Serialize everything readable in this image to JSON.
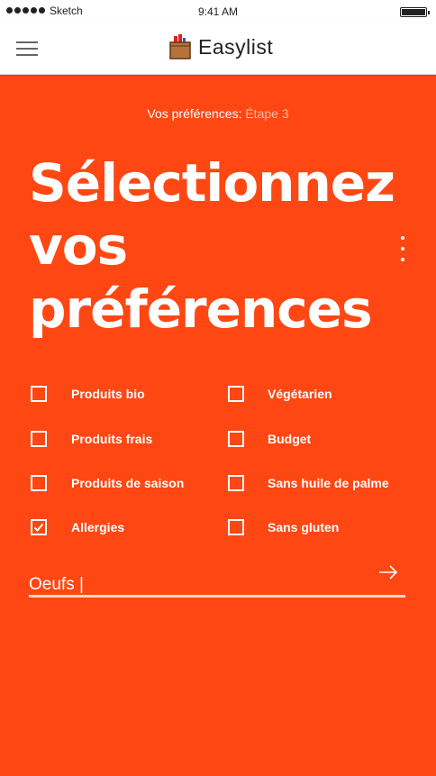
{
  "status_bar": {
    "carrier": "Sketch",
    "time": "9:41 AM"
  },
  "header": {
    "menu_icon": "hamburger-menu-icon",
    "logo_icon": "grocery-bag-icon",
    "app_name": "Easylist"
  },
  "step": {
    "label": "Vos préférences:",
    "step": "Étape 3"
  },
  "headline": {
    "line1": "Sélectionnez",
    "line2": "vos",
    "line3": "préférences"
  },
  "more_icon": "vertical-ellipsis-icon",
  "preferences": [
    {
      "label": "Produits bio",
      "checked": false
    },
    {
      "label": "Végétarien",
      "checked": false
    },
    {
      "label": "Produits frais",
      "checked": false
    },
    {
      "label": "Budget",
      "checked": false
    },
    {
      "label": "Produits de saison",
      "checked": false
    },
    {
      "label": "Sans huile de palme",
      "checked": false
    },
    {
      "label": "Allergies",
      "checked": true
    },
    {
      "label": "Sans gluten",
      "checked": false
    }
  ],
  "allergy_input": {
    "value": "Oeufs |"
  },
  "submit_icon": "arrow-right-icon",
  "colors": {
    "accent": "#ff4713",
    "underline": "#ffd6c6",
    "step_muted": "#ffb89e"
  }
}
